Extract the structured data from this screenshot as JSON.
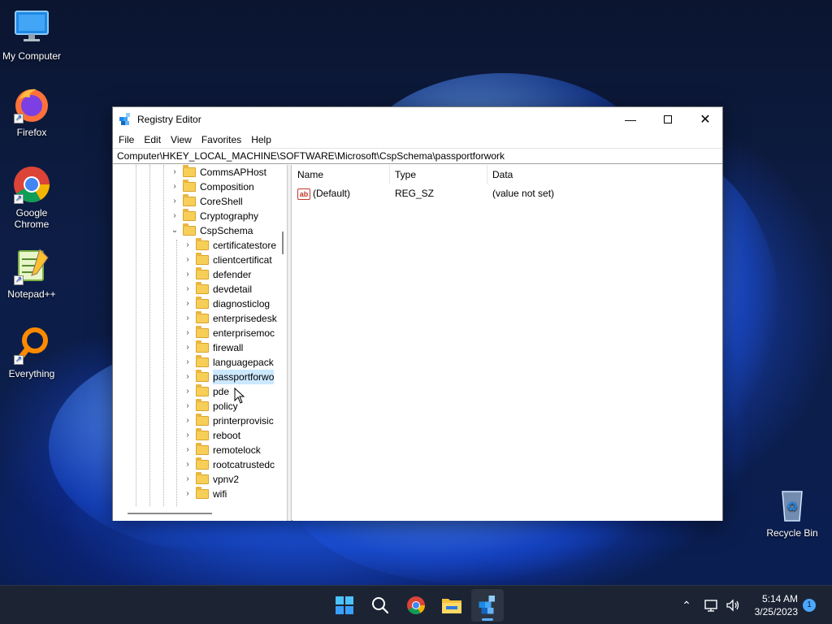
{
  "desktop": {
    "icons": [
      {
        "label": "My Computer"
      },
      {
        "label": "Firefox"
      },
      {
        "label": "Google Chrome"
      },
      {
        "label": "Notepad++"
      },
      {
        "label": "Everything"
      },
      {
        "label": "Recycle Bin"
      }
    ]
  },
  "window": {
    "title": "Registry Editor",
    "menu": [
      "File",
      "Edit",
      "View",
      "Favorites",
      "Help"
    ],
    "address": "Computer\\HKEY_LOCAL_MACHINE\\SOFTWARE\\Microsoft\\CspSchema\\passportforwork",
    "tree": [
      {
        "label": "CommsAPHost",
        "expanded": false
      },
      {
        "label": "Composition",
        "expanded": false
      },
      {
        "label": "CoreShell",
        "expanded": false
      },
      {
        "label": "Cryptography",
        "expanded": false
      },
      {
        "label": "CspSchema",
        "expanded": true
      },
      {
        "label": "certificatestore",
        "expanded": false
      },
      {
        "label": "clientcertificat",
        "expanded": false
      },
      {
        "label": "defender",
        "expanded": false
      },
      {
        "label": "devdetail",
        "expanded": false
      },
      {
        "label": "diagnosticlog",
        "expanded": false
      },
      {
        "label": "enterprisedesk",
        "expanded": false
      },
      {
        "label": "enterprisemoc",
        "expanded": false
      },
      {
        "label": "firewall",
        "expanded": false
      },
      {
        "label": "languagepack",
        "expanded": false
      },
      {
        "label": "passportforwo",
        "expanded": false,
        "selected": true
      },
      {
        "label": "pde",
        "expanded": false
      },
      {
        "label": "policy",
        "expanded": false
      },
      {
        "label": "printerprovisic",
        "expanded": false
      },
      {
        "label": "reboot",
        "expanded": false
      },
      {
        "label": "remotelock",
        "expanded": false
      },
      {
        "label": "rootcatrustedc",
        "expanded": false
      },
      {
        "label": "vpnv2",
        "expanded": false
      },
      {
        "label": "wifi",
        "expanded": false
      }
    ],
    "columns": {
      "name": "Name",
      "type": "Type",
      "data": "Data"
    },
    "values": [
      {
        "icon": "ab",
        "name": "(Default)",
        "type": "REG_SZ",
        "data": "(value not set)"
      }
    ]
  },
  "taskbar": {
    "time": "5:14 AM",
    "date": "3/25/2023",
    "notification_count": "1"
  }
}
